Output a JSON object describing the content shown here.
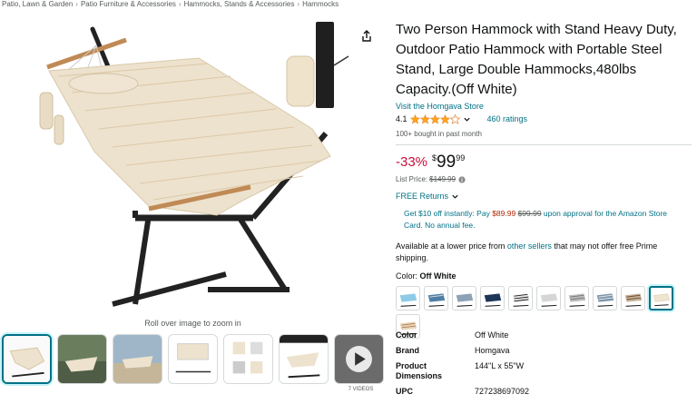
{
  "breadcrumb": [
    "Patio, Lawn & Garden",
    "Patio Furniture & Accessories",
    "Hammocks, Stands & Accessories",
    "Hammocks"
  ],
  "gallery": {
    "roll_over_text": "Roll over image to zoom in",
    "videos_label": "7 VIDEOS"
  },
  "product": {
    "title": "Two Person Hammock with Stand Heavy Duty, Outdoor Patio Hammock with Portable Steel Stand, Large Double Hammocks,480lbs Capacity.(Off White)",
    "store_link": "Visit the Homgava Store",
    "rating": "4.1",
    "rating_stars": 4.1,
    "ratings_count": "460 ratings",
    "bought": "100+ bought in past month"
  },
  "price": {
    "discount": "-33%",
    "currency": "$",
    "whole": "99",
    "fraction": "99",
    "list_label": "List Price:",
    "list_value": "$149.99"
  },
  "returns": "FREE Returns",
  "offer": {
    "part1": "Get $10 off instantly: Pay ",
    "new_price": "$89.99",
    "old_price": "$99.99",
    "part2": " upon approval for the Amazon Store Card. No annual fee."
  },
  "availability": {
    "part1": "Available at a lower price from ",
    "link": "other sellers",
    "part2": " that may not offer free Prime shipping."
  },
  "color": {
    "label": "Color: ",
    "value": "Off White",
    "swatches": [
      "light-blue",
      "blue-stripe",
      "grey-blue",
      "navy",
      "black-white-stripe",
      "light-grey",
      "grey-stripe",
      "blue-grey-stripe",
      "brown-stripe",
      "off-white",
      "tan-stripe"
    ]
  },
  "specs": [
    {
      "key": "Color",
      "value": "Off White"
    },
    {
      "key": "Brand",
      "value": "Homgava"
    },
    {
      "key": "Product Dimensions",
      "value": "144\"L x 55\"W"
    },
    {
      "key": "UPC",
      "value": "727238697092"
    }
  ],
  "colors": {
    "link": "#007185",
    "deal_red": "#cc0c39",
    "star": "#ffa41c"
  }
}
